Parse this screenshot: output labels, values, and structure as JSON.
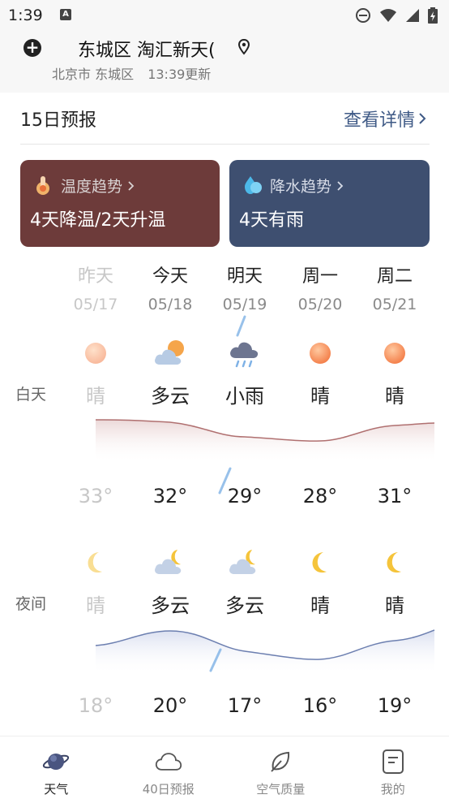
{
  "status": {
    "time": "1:39",
    "app_icon_letter": "A"
  },
  "header": {
    "location_title": "东城区 淘汇新天(",
    "city": "北京市 东城区",
    "updated": "13:39更新"
  },
  "forecast": {
    "title": "15日预报",
    "detail_link": "查看详情"
  },
  "cards": {
    "temp": {
      "label": "温度趋势",
      "value": "4天降温/2天升温",
      "color": "#6d3b3a"
    },
    "rain": {
      "label": "降水趋势",
      "value": "4天有雨",
      "color": "#3e4f70"
    }
  },
  "row_labels": {
    "day": "白天",
    "night": "夜间"
  },
  "days": [
    {
      "name": "昨天",
      "date": "05/17",
      "day_cond": "晴",
      "day_icon": "sun-icon",
      "day_temp": "33°",
      "night_cond": "晴",
      "night_icon": "moon-icon",
      "night_temp": "18°"
    },
    {
      "name": "今天",
      "date": "05/18",
      "day_cond": "多云",
      "day_icon": "partly-cloudy-day-icon",
      "day_temp": "32°",
      "night_cond": "多云",
      "night_icon": "partly-cloudy-night-icon",
      "night_temp": "20°"
    },
    {
      "name": "明天",
      "date": "05/19",
      "day_cond": "小雨",
      "day_icon": "light-rain-icon",
      "day_temp": "29°",
      "night_cond": "多云",
      "night_icon": "partly-cloudy-night-icon",
      "night_temp": "17°"
    },
    {
      "name": "周一",
      "date": "05/20",
      "day_cond": "晴",
      "day_icon": "sun-icon",
      "day_temp": "28°",
      "night_cond": "晴",
      "night_icon": "moon-icon",
      "night_temp": "16°"
    },
    {
      "name": "周二",
      "date": "05/21",
      "day_cond": "晴",
      "day_icon": "sun-icon",
      "day_temp": "31°",
      "night_cond": "晴",
      "night_icon": "moon-icon",
      "night_temp": "19°"
    }
  ],
  "nav": [
    {
      "label": "天气",
      "icon": "planet-icon",
      "active": true
    },
    {
      "label": "40日预报",
      "icon": "cloud-icon",
      "active": false
    },
    {
      "label": "空气质量",
      "icon": "leaf-icon",
      "active": false
    },
    {
      "label": "我的",
      "icon": "profile-card-icon",
      "active": false
    }
  ],
  "colors": {
    "accent": "#3f5a86",
    "day_curve": "#b07070",
    "night_curve": "#6c7fb0"
  }
}
